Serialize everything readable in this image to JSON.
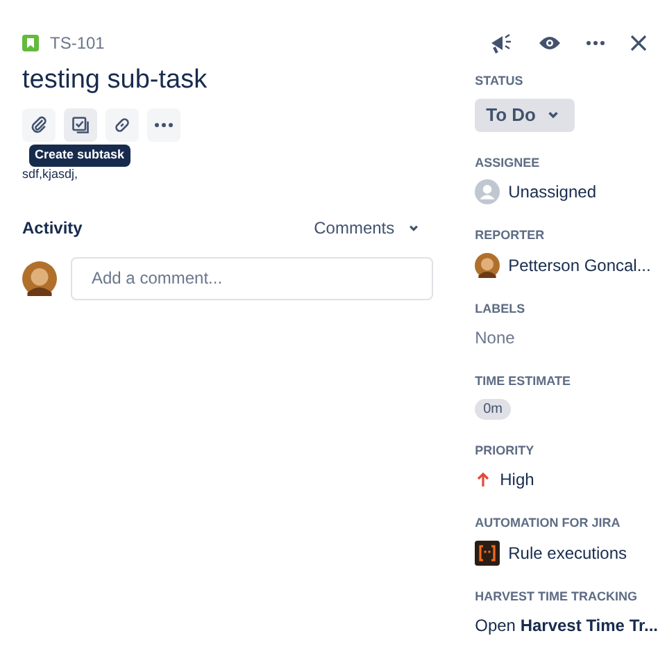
{
  "issue": {
    "key": "TS-101",
    "title": "testing sub-task",
    "description": "sdf,kjasdj,"
  },
  "tooltip": "Create subtask",
  "activity": {
    "heading": "Activity",
    "filter": "Comments",
    "comment_placeholder": "Add a comment..."
  },
  "fields": [
    {
      "kind": "status",
      "label": "STATUS",
      "value": "To Do"
    },
    {
      "kind": "user",
      "label": "ASSIGNEE",
      "value": "Unassigned",
      "avatar": false
    },
    {
      "kind": "user",
      "label": "REPORTER",
      "value": "Petterson Goncal...",
      "avatar": true
    },
    {
      "kind": "text",
      "label": "LABELS",
      "value": "None"
    },
    {
      "kind": "badge",
      "label": "TIME ESTIMATE",
      "value": "0m"
    },
    {
      "kind": "priority",
      "label": "PRIORITY",
      "value": "High"
    },
    {
      "kind": "app",
      "label": "AUTOMATION FOR JIRA",
      "value": "Rule executions"
    },
    {
      "kind": "link",
      "label": "HARVEST TIME TRACKING",
      "value": "Open **Harvest Time Tr...**"
    }
  ]
}
